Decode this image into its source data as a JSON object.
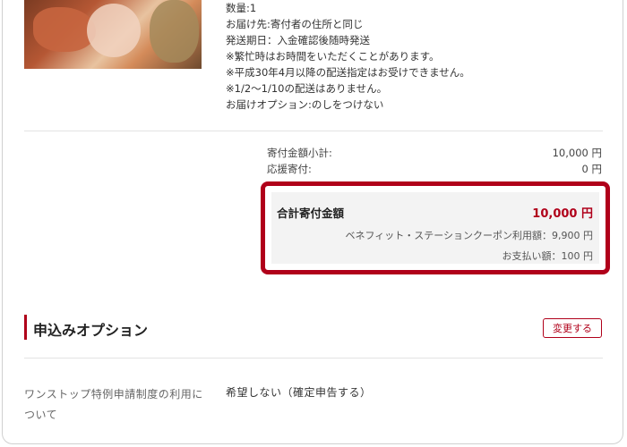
{
  "item": {
    "image_alt": "seafood product image",
    "lines": [
      "数量:1",
      "お届け先:寄付者の住所と同じ",
      "発送期日：入金確認後随時発送",
      "※繁忙時はお時間をいただくことがあります。",
      "※平成30年4月以降の配送指定はお受けできません。",
      "※1/2〜1/10の配送はありません。",
      "お届けオプション:のしをつけない"
    ]
  },
  "summary": {
    "subtotal_label": "寄付金額小計:",
    "subtotal_value": "10,000 円",
    "support_label": "応援寄付:",
    "support_value": "0 円"
  },
  "total": {
    "title": "合計寄付金額",
    "amount": "10,000 円",
    "coupon": "ベネフィット・ステーションクーポン利用額：9,900 円",
    "payment": "お支払い額：100 円",
    "highlight_color": "#b0001a"
  },
  "options": {
    "title": "申込みオプション",
    "change_button": "変更する",
    "onestop_label": "ワンストップ特例申請制度の利用について",
    "onestop_value": "希望しない（確定申告する）"
  }
}
